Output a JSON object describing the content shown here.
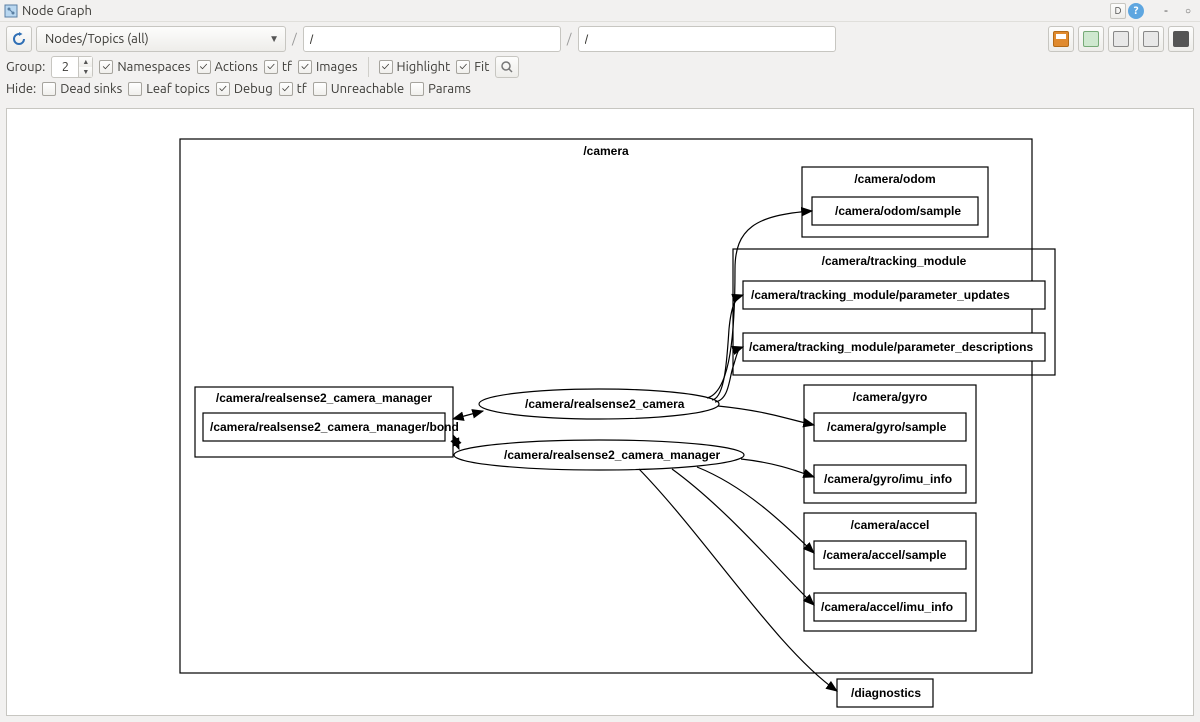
{
  "window": {
    "title": "Node Graph",
    "d_button": "D"
  },
  "toolbar": {
    "combo_label": "Nodes/Topics (all)",
    "filter1": "/",
    "filter2": "/"
  },
  "row2": {
    "group_label": "Group:",
    "group_value": "2",
    "namespaces": "Namespaces",
    "actions": "Actions",
    "tf": "tf",
    "images": "Images",
    "highlight": "Highlight",
    "fit": "Fit"
  },
  "row3": {
    "hide_label": "Hide:",
    "dead_sinks": "Dead sinks",
    "leaf_topics": "Leaf topics",
    "debug": "Debug",
    "tf": "tf",
    "unreachable": "Unreachable",
    "params": "Params"
  },
  "graph": {
    "camera": "/camera",
    "mgr_cluster": "/camera/realsense2_camera_manager",
    "mgr_bond": "/camera/realsense2_camera_manager/bond",
    "node_camera": "/camera/realsense2_camera",
    "node_mgr": "/camera/realsense2_camera_manager",
    "odom_cluster": "/camera/odom",
    "odom_sample": "/camera/odom/sample",
    "track_cluster": "/camera/tracking_module",
    "track_pu": "/camera/tracking_module/parameter_updates",
    "track_pd": "/camera/tracking_module/parameter_descriptions",
    "gyro_cluster": "/camera/gyro",
    "gyro_sample": "/camera/gyro/sample",
    "gyro_imu": "/camera/gyro/imu_info",
    "accel_cluster": "/camera/accel",
    "accel_sample": "/camera/accel/sample",
    "accel_imu": "/camera/accel/imu_info",
    "diagnostics": "/diagnostics"
  }
}
